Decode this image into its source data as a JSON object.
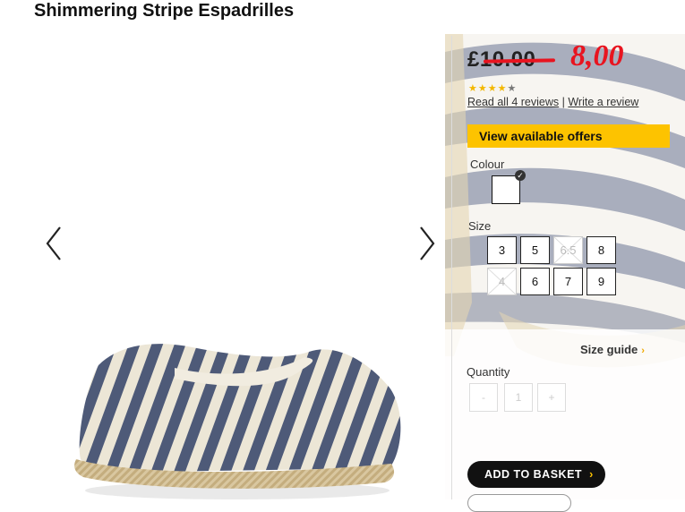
{
  "product": {
    "title": "Shimmering Stripe Espadrilles"
  },
  "price": {
    "old": "£10.00",
    "new": "8,00"
  },
  "rating": {
    "stars": 4.5,
    "max": 5,
    "read_reviews": "Read all 4 reviews",
    "separator": "|",
    "write_review": "Write a review"
  },
  "offers_button": "View available offers",
  "colour": {
    "label": "Colour"
  },
  "size": {
    "label": "Size",
    "options": [
      {
        "label": "3",
        "available": true
      },
      {
        "label": "5",
        "available": true
      },
      {
        "label": "6.5",
        "available": false
      },
      {
        "label": "8",
        "available": true
      },
      {
        "label": "4",
        "available": false
      },
      {
        "label": "6",
        "available": true
      },
      {
        "label": "7",
        "available": true
      },
      {
        "label": "9",
        "available": true
      }
    ],
    "guide": "Size guide",
    "guide_icon": "chevron-right-icon"
  },
  "quantity": {
    "label": "Quantity",
    "minus": "-",
    "value": "1",
    "plus": "+"
  },
  "basket_button": "ADD TO BASKET",
  "colors": {
    "accent": "#fdc300",
    "sale": "#e8141f"
  }
}
